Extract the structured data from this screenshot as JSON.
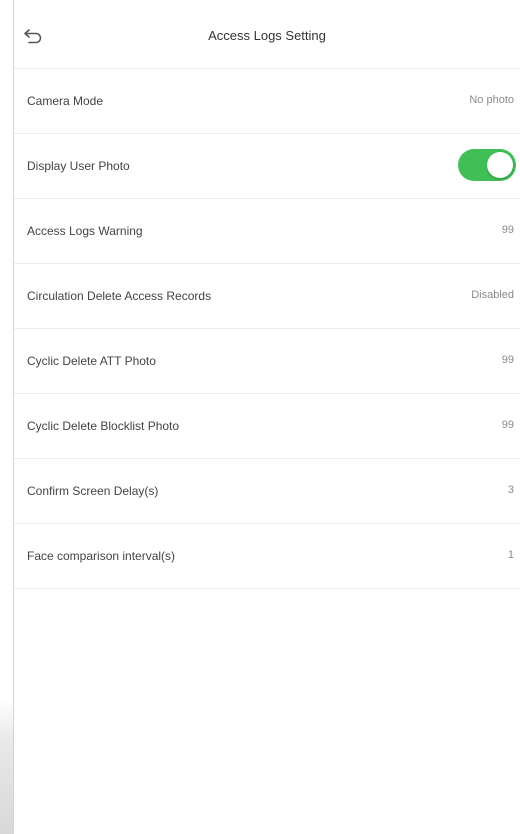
{
  "header": {
    "title": "Access Logs Setting",
    "back_icon": "return-arrow-icon"
  },
  "accent_color": "#3fbf55",
  "settings": [
    {
      "label": "Camera Mode",
      "value": "No photo"
    },
    {
      "label": "Display User Photo",
      "toggle": true
    },
    {
      "label": "Access Logs Warning",
      "value": "99"
    },
    {
      "label": "Circulation Delete Access Records",
      "value": "Disabled"
    },
    {
      "label": "Cyclic Delete ATT Photo",
      "value": "99"
    },
    {
      "label": "Cyclic Delete Blocklist Photo",
      "value": "99"
    },
    {
      "label": "Confirm Screen Delay(s)",
      "value": "3"
    },
    {
      "label": "Face comparison interval(s)",
      "value": "1"
    }
  ]
}
